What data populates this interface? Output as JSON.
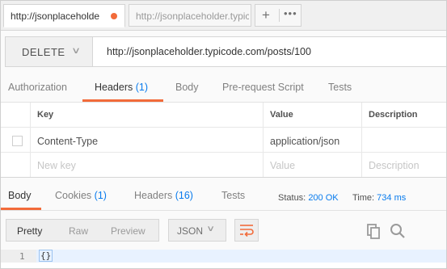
{
  "tabs": [
    {
      "title": "http://jsonplaceholde",
      "unsaved": true
    },
    {
      "title": "http://jsonplaceholder.typic",
      "unsaved": false
    }
  ],
  "tab_actions": {
    "new_tab": "+",
    "more": "•••"
  },
  "request": {
    "method": "DELETE",
    "url": "http://jsonplaceholder.typicode.com/posts/100"
  },
  "request_tabs": [
    {
      "label": "Authorization",
      "count": ""
    },
    {
      "label": "Headers",
      "count": "(1)"
    },
    {
      "label": "Body",
      "count": ""
    },
    {
      "label": "Pre-request Script",
      "count": ""
    },
    {
      "label": "Tests",
      "count": ""
    }
  ],
  "headers_table": {
    "columns": [
      "Key",
      "Value",
      "Description"
    ],
    "rows": [
      {
        "key": "Content-Type",
        "value": "application/json",
        "description": ""
      }
    ],
    "placeholder": {
      "key": "New key",
      "value": "Value",
      "description": "Description"
    }
  },
  "response": {
    "tabs": [
      {
        "label": "Body",
        "count": ""
      },
      {
        "label": "Cookies",
        "count": "(1)"
      },
      {
        "label": "Headers",
        "count": "(16)"
      },
      {
        "label": "Tests",
        "count": ""
      }
    ],
    "status_label": "Status:",
    "status_value": "200 OK",
    "time_label": "Time:",
    "time_value": "734 ms",
    "view_modes": [
      "Pretty",
      "Raw",
      "Preview"
    ],
    "format": "JSON",
    "lines": [
      {
        "number": "1",
        "text": "{}"
      }
    ]
  },
  "colors": {
    "accent": "#f26b3a",
    "link_blue": "#097bed"
  },
  "icons": [
    "wrap-lines-icon",
    "copy-icon",
    "search-icon"
  ]
}
